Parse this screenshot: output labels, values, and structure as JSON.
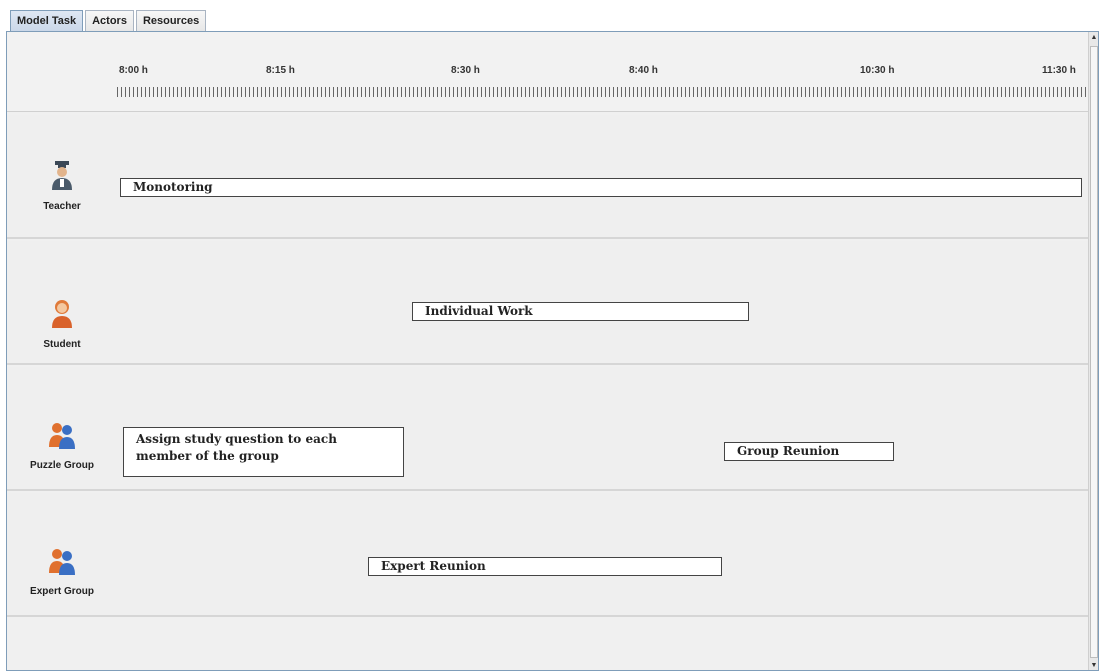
{
  "tabs": [
    {
      "label": "Model Task",
      "active": true
    },
    {
      "label": "Actors",
      "active": false
    },
    {
      "label": "Resources",
      "active": false
    }
  ],
  "timeline": {
    "ticks": [
      "8:00 h",
      "8:15 h",
      "8:30 h",
      "8:40 h",
      "10:30 h",
      "11:30 h"
    ]
  },
  "lanes": [
    {
      "actor": "Teacher",
      "icon": "teacher-icon",
      "tasks": [
        {
          "label": "Monotoring"
        }
      ]
    },
    {
      "actor": "Student",
      "icon": "student-icon",
      "tasks": [
        {
          "label": "Individual Work"
        }
      ]
    },
    {
      "actor": "Puzzle Group",
      "icon": "group-icon",
      "tasks": [
        {
          "label": "Assign study question to each member of the group"
        },
        {
          "label": "Group Reunion"
        }
      ]
    },
    {
      "actor": "Expert Group",
      "icon": "group-icon",
      "tasks": [
        {
          "label": "Expert Reunion"
        }
      ]
    }
  ],
  "colors": {
    "tab_active": "#c9d6e8",
    "panel_bg": "#f0f0f0",
    "task_border": "#444444",
    "teacher_icon": "#4a5a6a",
    "student_icon": "#d9622b",
    "group_icon_a": "#e0702e",
    "group_icon_b": "#3a6fc4"
  }
}
